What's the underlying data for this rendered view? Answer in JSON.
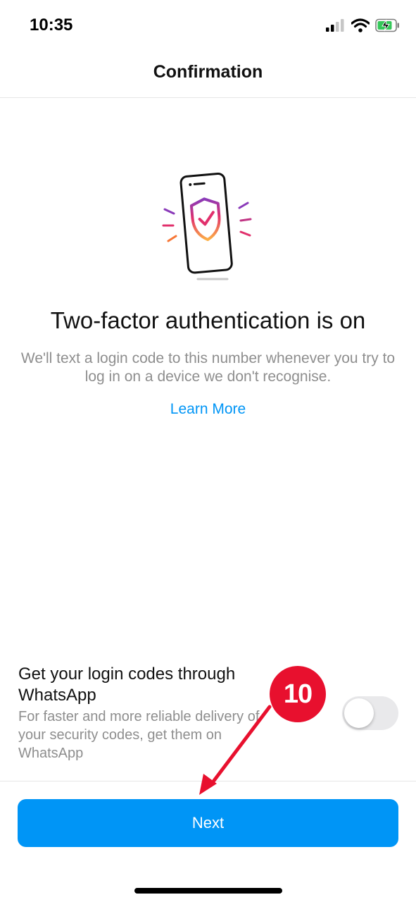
{
  "status_bar": {
    "time": "10:35",
    "icons": [
      "signal-icon",
      "wifi-icon",
      "battery-charging-icon"
    ]
  },
  "header": {
    "title": "Confirmation"
  },
  "main": {
    "illustration": "phone-shield-check-icon",
    "headline": "Two-factor authentication is on",
    "description": "We'll text a login code to this number whenever you try to log in on a device we don't recognise.",
    "learn_more_label": "Learn More"
  },
  "whatsapp_option": {
    "title": "Get your login codes through WhatsApp",
    "description": "For faster and more reliable delivery of your security codes, get them on WhatsApp",
    "enabled": false
  },
  "footer": {
    "next_label": "Next"
  },
  "annotation": {
    "step_number": "10",
    "color": "#e8102e"
  },
  "colors": {
    "accent": "#0095f6",
    "muted_text": "#8e8e8e",
    "toggle_off": "#e9e9eb"
  }
}
